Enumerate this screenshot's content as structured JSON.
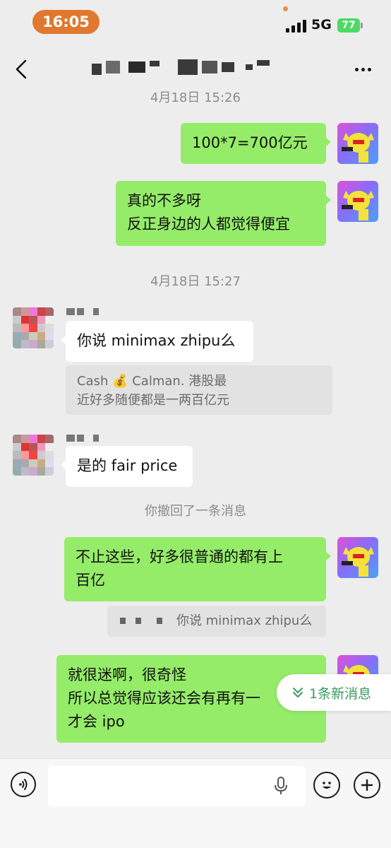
{
  "status_bar": {
    "time": "16:05",
    "network": "5G",
    "battery": "77"
  },
  "chat": {
    "timestamp_1": "4月18日 15:26",
    "msg_1": "100*7=700亿元",
    "msg_2": "真的不多呀\n反正身边的人都觉得便宜",
    "timestamp_2": "4月18日 15:27",
    "msg_3": "你说 minimax zhipu么",
    "quote_1": "Cash 💰 Calman.              港股最\n近好多随便都是一两百亿元",
    "msg_4": "是的 fair price",
    "recall_notice": "你撤回了一条消息",
    "msg_5": "不止这些，好多很普通的都有上\n百亿",
    "quote_2": "你说 minimax zhipu么",
    "msg_6": "就很迷啊，很奇怪\n所以总觉得应该还会有再有一\n才会 ipo"
  },
  "new_messages": {
    "label": "1条新消息"
  },
  "icons": {
    "back": "chevron-left-icon",
    "more": "more-dots-icon",
    "voice": "voice-icon",
    "mic": "mic-icon",
    "emoji": "emoji-icon",
    "plus": "plus-icon",
    "new_msg": "double-chevron-down-icon"
  },
  "colors": {
    "my_bubble": "#95ec69",
    "their_bubble": "#ffffff",
    "new_msg_text": "#3a9b5c"
  }
}
